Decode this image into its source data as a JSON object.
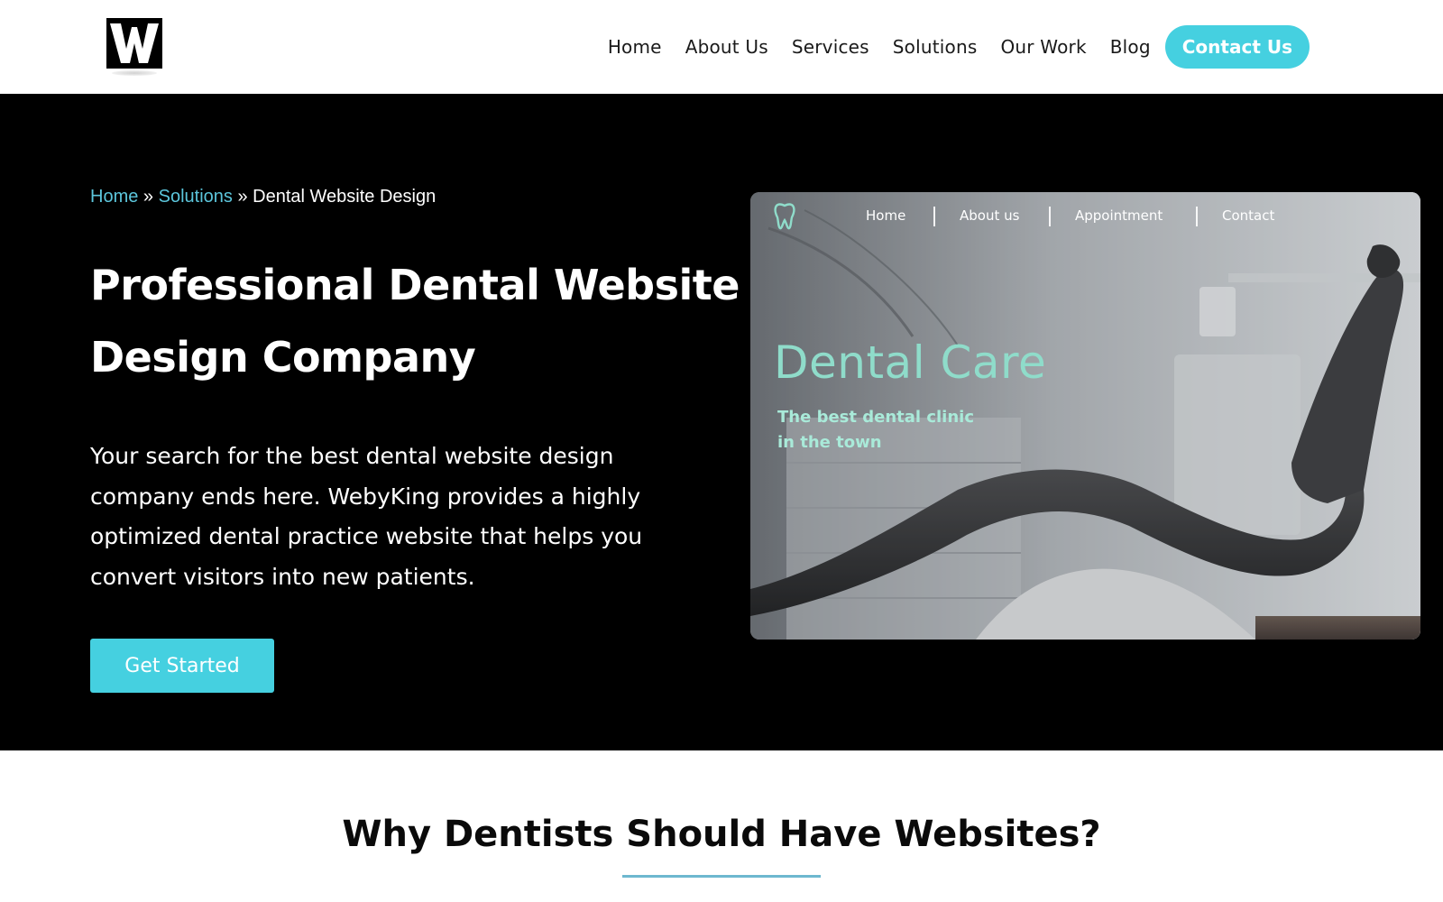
{
  "header": {
    "logo_letter": "W",
    "nav": [
      "Home",
      "About Us",
      "Services",
      "Solutions",
      "Our Work",
      "Blog"
    ],
    "contact_label": "Contact Us"
  },
  "hero": {
    "breadcrumb": {
      "home": "Home",
      "sep1": " » ",
      "solutions": "Solutions",
      "sep2": " » ",
      "current": "Dental Website Design"
    },
    "title": "Professional Dental Website Design Company",
    "description": "Your search for the best dental website design company ends here. WebyKing provides a highly optimized dental practice website that helps you convert visitors into new patients.",
    "cta_label": "Get Started"
  },
  "preview": {
    "nav": [
      "Home",
      "About us",
      "Appointment",
      "Contact"
    ],
    "title": "Dental Care",
    "subtitle": "The best dental clinic in the town"
  },
  "section2": {
    "title": "Why Dentists Should Have Websites?"
  },
  "colors": {
    "accent": "#45d0e0",
    "breadcrumb_link": "#5cc6dc",
    "hero_bg": "#000000",
    "preview_title": "#8fdcca",
    "underline": "#6db8cf"
  },
  "icons": {
    "logo": "w-logo-icon",
    "preview_logo": "tooth-icon"
  }
}
